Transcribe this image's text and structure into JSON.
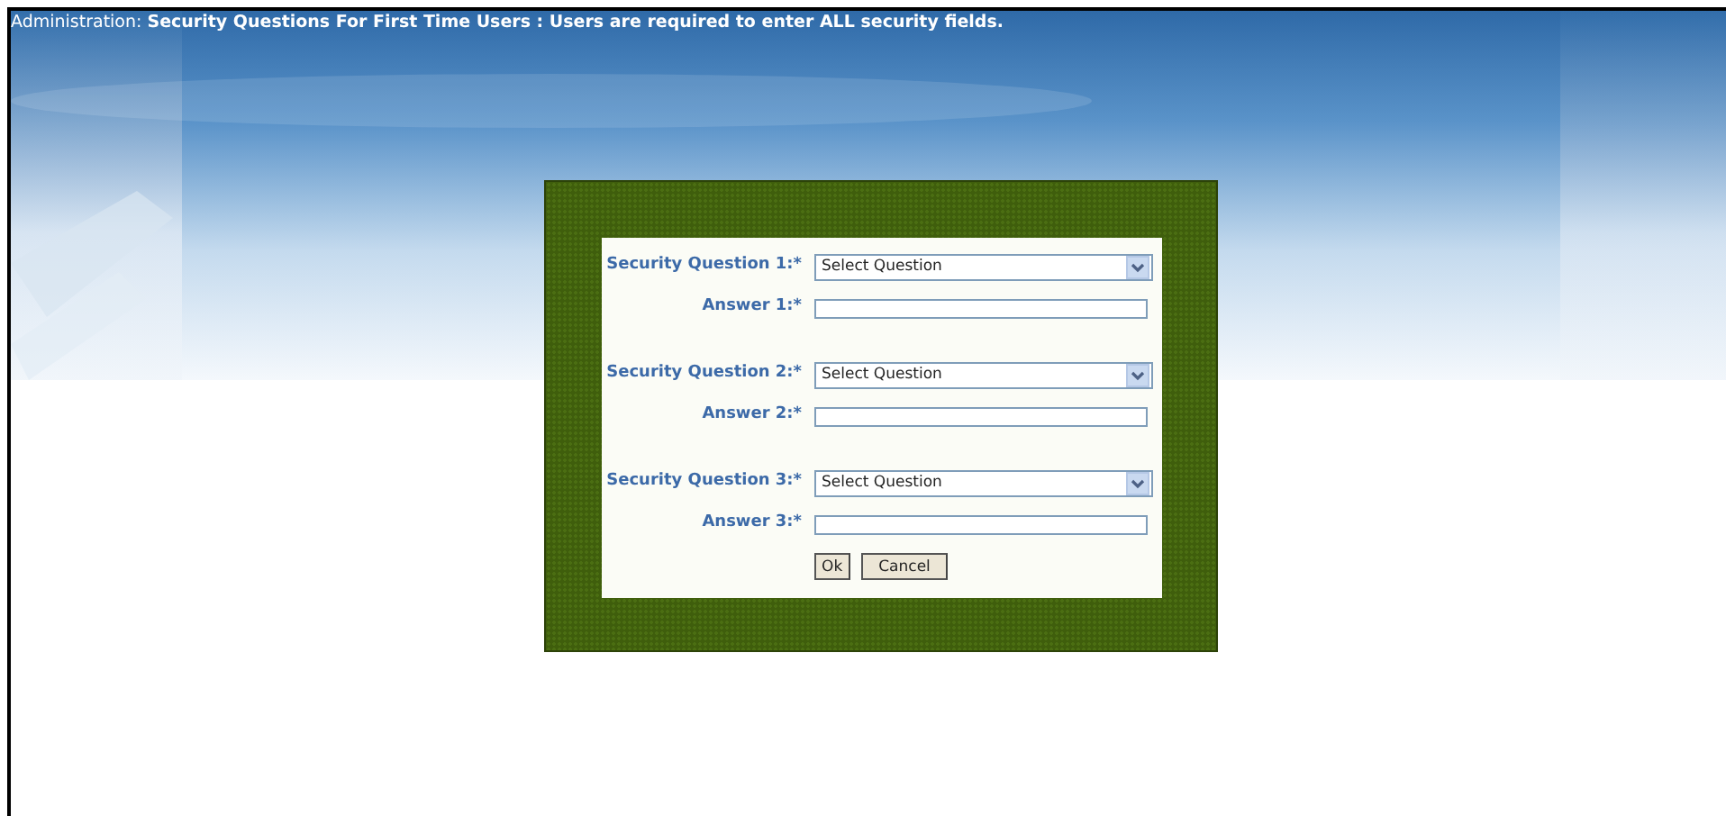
{
  "header": {
    "section": "Administration:",
    "title": "Security Questions For First Time Users : Users are required to enter ALL security fields."
  },
  "questions": [
    {
      "label": "Security Question 1:*",
      "select_value": "Select Question",
      "answer_label": "Answer 1:*"
    },
    {
      "label": "Security Question 2:*",
      "select_value": "Select Question",
      "answer_label": "Answer 2:*"
    },
    {
      "label": "Security Question 3:*",
      "select_value": "Select Question",
      "answer_label": "Answer 3:*"
    }
  ],
  "buttons": [
    {
      "label": "Ok"
    },
    {
      "label": "Cancel"
    }
  ]
}
